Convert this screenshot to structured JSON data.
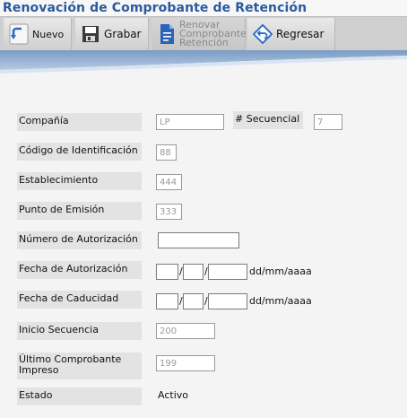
{
  "window": {
    "title": "Renovación de Comprobante de Retención"
  },
  "toolbar": {
    "nuevo": "Nuevo",
    "grabar": "Grabar",
    "renovar_line1": "Renovar",
    "renovar_line2": "Comprobante",
    "renovar_line3": "Retención",
    "regresar": "Regresar"
  },
  "colors": {
    "title": "#2a5a9c",
    "band_dark": "#7a9cc4",
    "band_light": "#e6eef8"
  },
  "form": {
    "compania_label": "Compañía",
    "compania_value": "LP",
    "secuencial_label": "# Secuencial",
    "secuencial_value": "7",
    "codigo_label": "Código de Identificación",
    "codigo_value": "88",
    "establecimiento_label": "Establecimiento",
    "establecimiento_value": "444",
    "punto_label": "Punto de Emisión",
    "punto_value": "333",
    "autorizacion_label": "Número de Autorización",
    "autorizacion_value": "",
    "fecha_aut_label": "Fecha de Autorización",
    "fecha_cad_label": "Fecha de Caducidad",
    "date_sep": "/",
    "date_format": "dd/mm/aaaa",
    "inicio_label": "Inicio Secuencia",
    "inicio_value": "200",
    "ultimo_label_line1": "Último Comprobante",
    "ultimo_label_line2": "Impreso",
    "ultimo_value": "199",
    "estado_label": "Estado",
    "estado_value": "Activo"
  }
}
